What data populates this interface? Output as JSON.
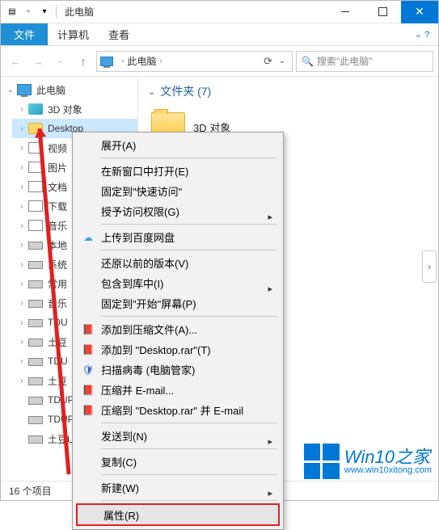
{
  "titlebar": {
    "title": "此电脑"
  },
  "ribbon": {
    "file": "文件",
    "tabs": [
      "计算机",
      "查看"
    ]
  },
  "nav": {
    "crumb": "此电脑",
    "search_placeholder": "搜索\"此电脑\""
  },
  "tree": {
    "root": "此电脑",
    "items": [
      {
        "label": "3D 对象",
        "icon": "cube",
        "chev": "closed"
      },
      {
        "label": "Desktop",
        "icon": "folder",
        "chev": "closed",
        "selected": true
      },
      {
        "label": "视频",
        "icon": "video",
        "chev": "closed"
      },
      {
        "label": "图片",
        "icon": "pic",
        "chev": "closed"
      },
      {
        "label": "文档",
        "icon": "doc",
        "chev": "closed"
      },
      {
        "label": "下载",
        "icon": "down",
        "chev": "closed"
      },
      {
        "label": "音乐",
        "icon": "music",
        "chev": "closed"
      },
      {
        "label": "本地",
        "icon": "drive",
        "chev": "closed"
      },
      {
        "label": "系统",
        "icon": "drive",
        "chev": "closed"
      },
      {
        "label": "常用",
        "icon": "drive",
        "chev": "closed"
      },
      {
        "label": "音乐",
        "icon": "drive",
        "chev": "closed"
      },
      {
        "label": "TDU",
        "icon": "drive",
        "chev": "closed"
      },
      {
        "label": "土豆",
        "icon": "drive",
        "chev": "closed"
      },
      {
        "label": "TDU",
        "icon": "drive",
        "chev": "closed"
      },
      {
        "label": "土豆",
        "icon": "drive",
        "chev": "closed"
      },
      {
        "label": "TDUP",
        "icon": "drive",
        "chev": "none"
      },
      {
        "label": "TDUP",
        "icon": "drive",
        "chev": "none"
      },
      {
        "label": "土豆U",
        "icon": "drive",
        "chev": "none"
      }
    ]
  },
  "content": {
    "section": "文件夹 (7)",
    "folder_label": "3D 对象"
  },
  "context_menu": {
    "items": [
      {
        "label": "展开(A)",
        "type": "item"
      },
      {
        "type": "sep"
      },
      {
        "label": "在新窗口中打开(E)",
        "type": "item"
      },
      {
        "label": "固定到\"快速访问\"",
        "type": "item"
      },
      {
        "label": "授予访问权限(G)",
        "type": "sub"
      },
      {
        "type": "sep"
      },
      {
        "label": "上传到百度网盘",
        "type": "item",
        "icon": "☁",
        "icolor": "#3aa0e0"
      },
      {
        "type": "sep"
      },
      {
        "label": "还原以前的版本(V)",
        "type": "item"
      },
      {
        "label": "包含到库中(I)",
        "type": "sub"
      },
      {
        "label": "固定到\"开始\"屏幕(P)",
        "type": "item"
      },
      {
        "type": "sep"
      },
      {
        "label": "添加到压缩文件(A)...",
        "type": "item",
        "icon": "📕",
        "icolor": "#b03020"
      },
      {
        "label": "添加到 \"Desktop.rar\"(T)",
        "type": "item",
        "icon": "📕",
        "icolor": "#b03020"
      },
      {
        "label": "扫描病毒 (电脑管家)",
        "type": "item",
        "icon": "🛡",
        "icolor": "#2060c0"
      },
      {
        "label": "压缩并 E-mail...",
        "type": "item",
        "icon": "📕",
        "icolor": "#b03020"
      },
      {
        "label": "压缩到 \"Desktop.rar\" 并 E-mail",
        "type": "item",
        "icon": "📕",
        "icolor": "#b03020"
      },
      {
        "type": "sep"
      },
      {
        "label": "发送到(N)",
        "type": "sub"
      },
      {
        "type": "sep"
      },
      {
        "label": "复制(C)",
        "type": "item"
      },
      {
        "type": "sep"
      },
      {
        "label": "新建(W)",
        "type": "sub"
      },
      {
        "type": "sep"
      },
      {
        "label": "属性(R)",
        "type": "item",
        "highlight": true
      }
    ]
  },
  "status": {
    "count": "16 个项目"
  },
  "watermark": {
    "main": "Win10之家",
    "sub": "www.win10xitong.com"
  }
}
